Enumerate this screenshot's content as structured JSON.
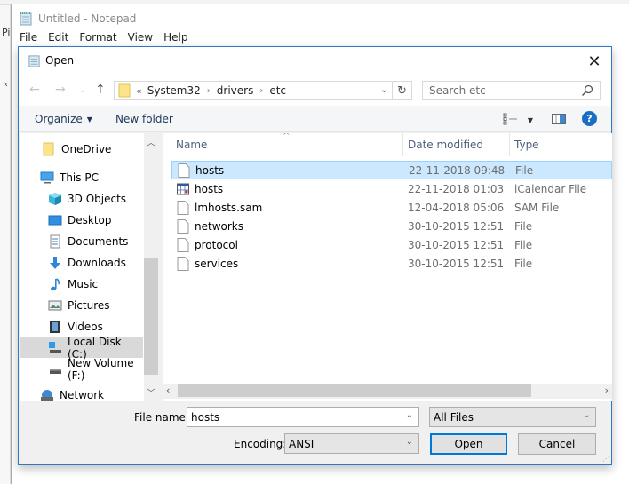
{
  "background": {
    "partial_label": "Pi"
  },
  "notepad": {
    "title": "Untitled - Notepad",
    "menu": [
      "File",
      "Edit",
      "Format",
      "View",
      "Help"
    ]
  },
  "dialog": {
    "title": "Open",
    "address": {
      "overflow": "«",
      "crumbs": [
        "System32",
        "drivers",
        "etc"
      ]
    },
    "search": {
      "placeholder": "Search etc"
    },
    "toolbar": {
      "organize": "Organize",
      "new_folder": "New folder"
    },
    "nav_pane": {
      "items": [
        {
          "label": "OneDrive",
          "icon": "folder-icon"
        },
        {
          "label": "This PC",
          "icon": "computer-icon"
        },
        {
          "label": "3D Objects",
          "icon": "cube-icon"
        },
        {
          "label": "Desktop",
          "icon": "desktop-icon"
        },
        {
          "label": "Documents",
          "icon": "document-icon"
        },
        {
          "label": "Downloads",
          "icon": "download-icon"
        },
        {
          "label": "Music",
          "icon": "music-icon"
        },
        {
          "label": "Pictures",
          "icon": "pictures-icon"
        },
        {
          "label": "Videos",
          "icon": "video-icon"
        },
        {
          "label": "Local Disk (C:)",
          "icon": "drive-icon",
          "selected": true
        },
        {
          "label": "New Volume (F:)",
          "icon": "drive-icon"
        },
        {
          "label": "Network",
          "icon": "network-icon"
        }
      ]
    },
    "file_list": {
      "columns": [
        "Name",
        "Date modified",
        "Type"
      ],
      "rows": [
        {
          "name": "hosts",
          "date": "22-11-2018 09:48",
          "type": "File",
          "icon": "file-icon",
          "selected": true
        },
        {
          "name": "hosts",
          "date": "22-11-2018 01:03",
          "type": "iCalendar File",
          "icon": "calendar-file-icon"
        },
        {
          "name": "lmhosts.sam",
          "date": "12-04-2018 05:06",
          "type": "SAM File",
          "icon": "file-icon"
        },
        {
          "name": "networks",
          "date": "30-10-2015 12:51",
          "type": "File",
          "icon": "file-icon"
        },
        {
          "name": "protocol",
          "date": "30-10-2015 12:51",
          "type": "File",
          "icon": "file-icon"
        },
        {
          "name": "services",
          "date": "30-10-2015 12:51",
          "type": "File",
          "icon": "file-icon"
        }
      ]
    },
    "bottom": {
      "file_name_label": "File name:",
      "file_name_value": "hosts",
      "file_type": "All Files",
      "encoding_label": "Encoding:",
      "encoding_value": "ANSI",
      "open_button": "Open",
      "cancel_button": "Cancel"
    }
  }
}
